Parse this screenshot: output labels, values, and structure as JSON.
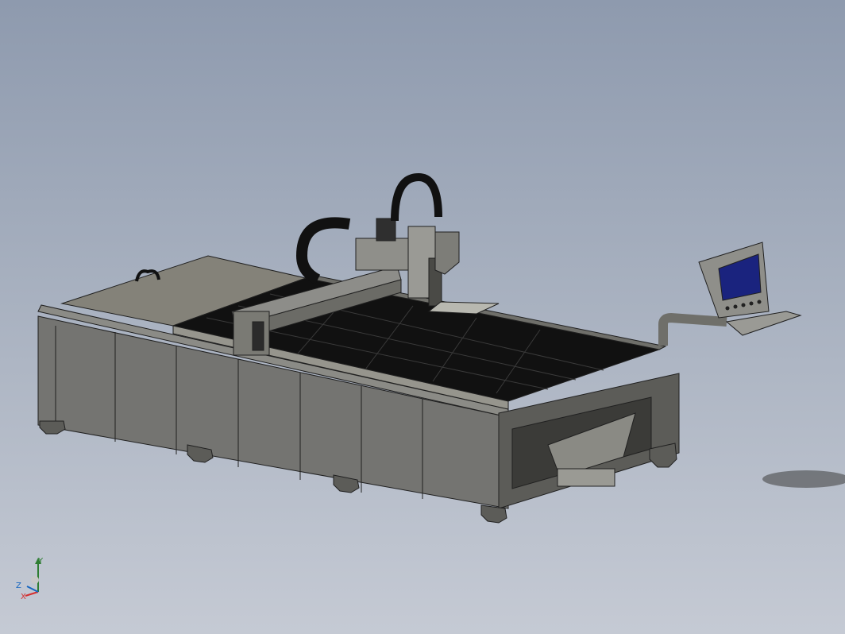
{
  "viewport": {
    "background_top": "#8e9aae",
    "background_bottom": "#c5cad4"
  },
  "model": {
    "body_color": "#75756f",
    "body_dark": "#4a4a46",
    "edge_color": "#202020",
    "cable_chain_color": "#111111",
    "monitor_screen_color": "#1a237e"
  },
  "triad": {
    "x_label": "X",
    "y_label": "Y",
    "z_label": "Z",
    "x_color": "#d32f2f",
    "y_color": "#2e7d32",
    "z_color": "#1565c0"
  }
}
